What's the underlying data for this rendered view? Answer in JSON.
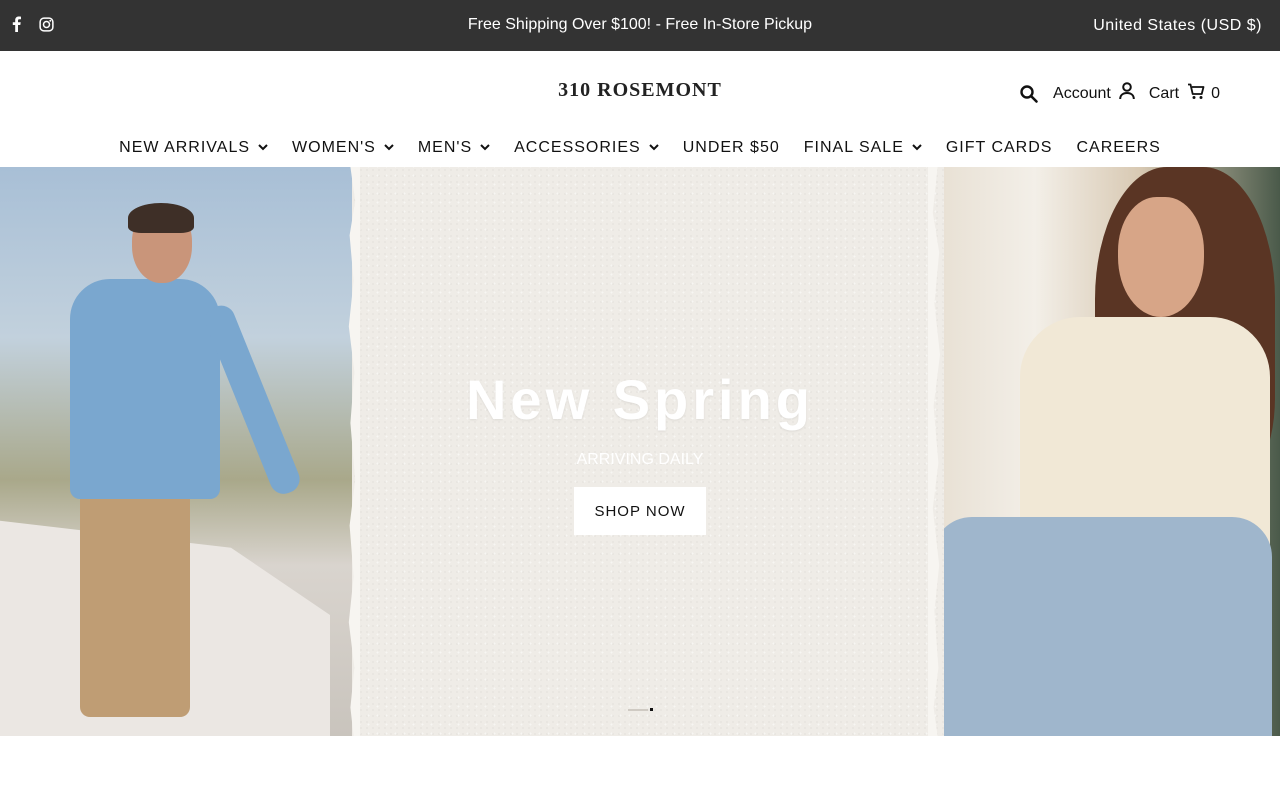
{
  "topbar": {
    "announcement": "Free Shipping Over $100! - Free In-Store Pickup",
    "currency": "United States (USD $)",
    "social": [
      "facebook-icon",
      "instagram-icon"
    ]
  },
  "header": {
    "logo": "310 ROSEMONT",
    "account_label": "Account",
    "cart_label": "Cart",
    "cart_count": "0"
  },
  "nav": {
    "items": [
      {
        "label": "NEW ARRIVALS",
        "dropdown": true
      },
      {
        "label": "WOMEN'S",
        "dropdown": true
      },
      {
        "label": "MEN'S",
        "dropdown": true
      },
      {
        "label": "ACCESSORIES",
        "dropdown": true
      },
      {
        "label": "UNDER $50",
        "dropdown": false
      },
      {
        "label": "FINAL SALE",
        "dropdown": true
      },
      {
        "label": "GIFT CARDS",
        "dropdown": false
      },
      {
        "label": "CAREERS",
        "dropdown": false
      }
    ]
  },
  "hero": {
    "title": "New Spring",
    "subtitle": "ARRIVING DAILY",
    "cta": "SHOP NOW",
    "slides": 2,
    "active_slide": 2
  },
  "colors": {
    "topbar_bg": "#333333",
    "paper": "#efece7",
    "text": "#111111"
  }
}
